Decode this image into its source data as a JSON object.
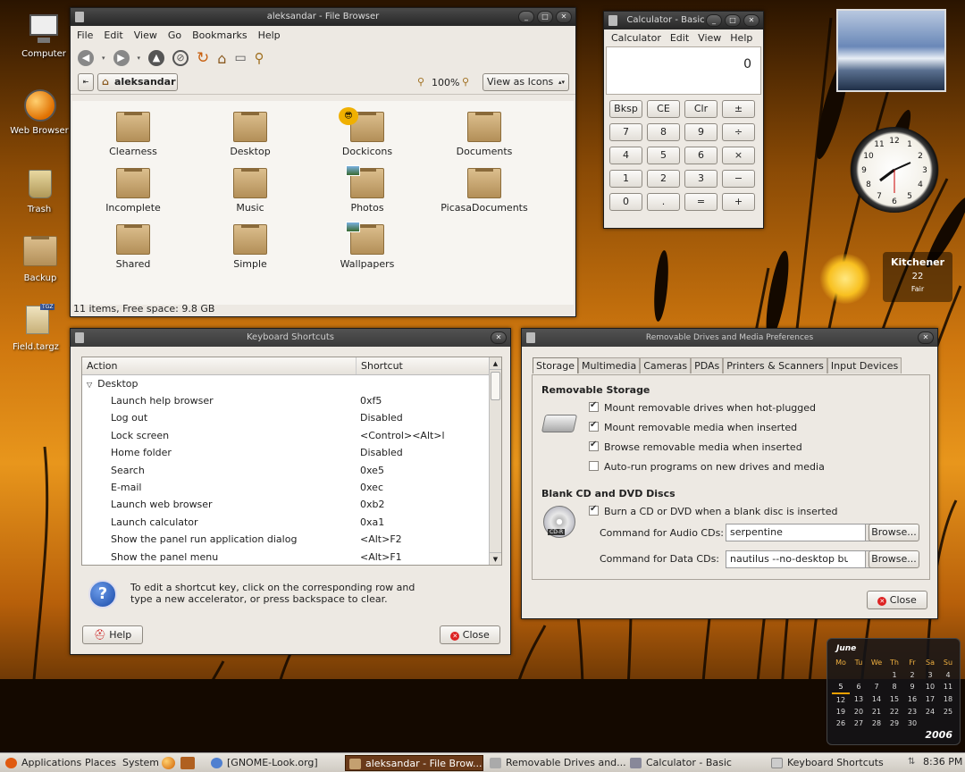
{
  "desktop": {
    "icons": [
      {
        "label": "Computer"
      },
      {
        "label": "Web Browser"
      },
      {
        "label": "Trash"
      },
      {
        "label": "Backup"
      },
      {
        "label": "Field.targz",
        "badge": "TGZ"
      }
    ]
  },
  "file_browser": {
    "title": "aleksandar - File Browser",
    "menu": [
      "File",
      "Edit",
      "View",
      "Go",
      "Bookmarks",
      "Help"
    ],
    "location": "aleksandar",
    "zoom": "100%",
    "view_mode": "View as Icons",
    "items": [
      "Clearness",
      "Desktop",
      "Dockicons",
      "Documents",
      "Incomplete",
      "Music",
      "Photos",
      "PicasaDocuments",
      "Shared",
      "Simple",
      "Wallpapers"
    ],
    "status": "11 items, Free space: 9.8 GB"
  },
  "calculator": {
    "title": "Calculator - Basic",
    "menu": [
      "Calculator",
      "Edit",
      "View",
      "Help"
    ],
    "display": "0",
    "keys": [
      [
        "Bksp",
        "CE",
        "Clr",
        "±"
      ],
      [
        "7",
        "8",
        "9",
        "÷"
      ],
      [
        "4",
        "5",
        "6",
        "×"
      ],
      [
        "1",
        "2",
        "3",
        "−"
      ],
      [
        "0",
        ".",
        "=",
        "+"
      ]
    ]
  },
  "weather": {
    "city": "Kitchener",
    "temp": "22",
    "condition": "Fair"
  },
  "keyboard_shortcuts": {
    "title": "Keyboard Shortcuts",
    "col_action": "Action",
    "col_shortcut": "Shortcut",
    "group": "Desktop",
    "rows": [
      {
        "action": "Launch help browser",
        "shortcut": "0xf5"
      },
      {
        "action": "Log out",
        "shortcut": "Disabled"
      },
      {
        "action": "Lock screen",
        "shortcut": "<Control><Alt>l"
      },
      {
        "action": "Home folder",
        "shortcut": "Disabled"
      },
      {
        "action": "Search",
        "shortcut": "0xe5"
      },
      {
        "action": "E-mail",
        "shortcut": "0xec"
      },
      {
        "action": "Launch web browser",
        "shortcut": "0xb2"
      },
      {
        "action": "Launch calculator",
        "shortcut": "0xa1"
      },
      {
        "action": "Show the panel run application dialog",
        "shortcut": "<Alt>F2"
      },
      {
        "action": "Show the panel menu",
        "shortcut": "<Alt>F1"
      }
    ],
    "info": "To edit a shortcut key, click on the corresponding row and type a new accelerator, or press backspace to clear.",
    "help_label": "Help",
    "close_label": "Close"
  },
  "removable": {
    "title": "Removable Drives and Media Preferences",
    "tabs": [
      "Storage",
      "Multimedia",
      "Cameras",
      "PDAs",
      "Printers & Scanners",
      "Input Devices"
    ],
    "storage_heading": "Removable Storage",
    "storage_options": [
      {
        "label": "Mount removable drives when hot-plugged",
        "checked": true
      },
      {
        "label": "Mount removable media when inserted",
        "checked": true
      },
      {
        "label": "Browse removable media when inserted",
        "checked": true
      },
      {
        "label": "Auto-run programs on new drives and media",
        "checked": false
      }
    ],
    "cd_heading": "Blank CD and DVD Discs",
    "burn_label": "Burn a CD or DVD when a blank disc is inserted",
    "audio_label": "Command for Audio CDs:",
    "audio_value": "serpentine",
    "data_label": "Command for Data CDs:",
    "data_value": "nautilus --no-desktop bu",
    "browse_label": "Browse...",
    "cd_badge": "CD-R",
    "close_label": "Close"
  },
  "calendar": {
    "month": "June",
    "year": "2006",
    "days": [
      "Mo",
      "Tu",
      "We",
      "Th",
      "Fr",
      "Sa",
      "Su"
    ],
    "weeks": [
      [
        "",
        "",
        "",
        "1",
        "2",
        "3",
        "4"
      ],
      [
        "5",
        "6",
        "7",
        "8",
        "9",
        "10",
        "11"
      ],
      [
        "12",
        "13",
        "14",
        "15",
        "16",
        "17",
        "18"
      ],
      [
        "19",
        "20",
        "21",
        "22",
        "23",
        "24",
        "25"
      ],
      [
        "26",
        "27",
        "28",
        "29",
        "30",
        "",
        ""
      ]
    ]
  },
  "taskbar": {
    "applications": "Applications",
    "places": "Places",
    "system": "System",
    "tasks": [
      "[GNOME-Look.org]",
      "aleksandar - File Brow...",
      "Removable Drives and...",
      "Calculator - Basic",
      "Keyboard Shortcuts"
    ],
    "clock": "8:36 PM"
  },
  "colors": {
    "accent": "#e8961c",
    "titlebar": "#2e2e2e",
    "panel": "#ede9e3"
  }
}
